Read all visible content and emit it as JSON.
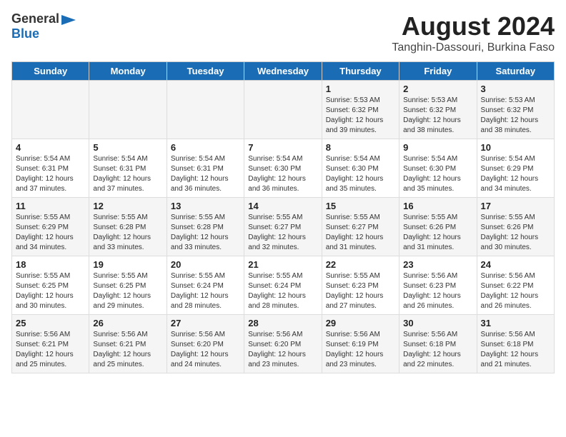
{
  "header": {
    "logo_general": "General",
    "logo_blue": "Blue",
    "title": "August 2024",
    "subtitle": "Tanghin-Dassouri, Burkina Faso"
  },
  "days_of_week": [
    "Sunday",
    "Monday",
    "Tuesday",
    "Wednesday",
    "Thursday",
    "Friday",
    "Saturday"
  ],
  "weeks": [
    [
      {
        "day": "",
        "info": ""
      },
      {
        "day": "",
        "info": ""
      },
      {
        "day": "",
        "info": ""
      },
      {
        "day": "",
        "info": ""
      },
      {
        "day": "1",
        "info": "Sunrise: 5:53 AM\nSunset: 6:32 PM\nDaylight: 12 hours and 39 minutes."
      },
      {
        "day": "2",
        "info": "Sunrise: 5:53 AM\nSunset: 6:32 PM\nDaylight: 12 hours and 38 minutes."
      },
      {
        "day": "3",
        "info": "Sunrise: 5:53 AM\nSunset: 6:32 PM\nDaylight: 12 hours and 38 minutes."
      }
    ],
    [
      {
        "day": "4",
        "info": "Sunrise: 5:54 AM\nSunset: 6:31 PM\nDaylight: 12 hours and 37 minutes."
      },
      {
        "day": "5",
        "info": "Sunrise: 5:54 AM\nSunset: 6:31 PM\nDaylight: 12 hours and 37 minutes."
      },
      {
        "day": "6",
        "info": "Sunrise: 5:54 AM\nSunset: 6:31 PM\nDaylight: 12 hours and 36 minutes."
      },
      {
        "day": "7",
        "info": "Sunrise: 5:54 AM\nSunset: 6:30 PM\nDaylight: 12 hours and 36 minutes."
      },
      {
        "day": "8",
        "info": "Sunrise: 5:54 AM\nSunset: 6:30 PM\nDaylight: 12 hours and 35 minutes."
      },
      {
        "day": "9",
        "info": "Sunrise: 5:54 AM\nSunset: 6:30 PM\nDaylight: 12 hours and 35 minutes."
      },
      {
        "day": "10",
        "info": "Sunrise: 5:54 AM\nSunset: 6:29 PM\nDaylight: 12 hours and 34 minutes."
      }
    ],
    [
      {
        "day": "11",
        "info": "Sunrise: 5:55 AM\nSunset: 6:29 PM\nDaylight: 12 hours and 34 minutes."
      },
      {
        "day": "12",
        "info": "Sunrise: 5:55 AM\nSunset: 6:28 PM\nDaylight: 12 hours and 33 minutes."
      },
      {
        "day": "13",
        "info": "Sunrise: 5:55 AM\nSunset: 6:28 PM\nDaylight: 12 hours and 33 minutes."
      },
      {
        "day": "14",
        "info": "Sunrise: 5:55 AM\nSunset: 6:27 PM\nDaylight: 12 hours and 32 minutes."
      },
      {
        "day": "15",
        "info": "Sunrise: 5:55 AM\nSunset: 6:27 PM\nDaylight: 12 hours and 31 minutes."
      },
      {
        "day": "16",
        "info": "Sunrise: 5:55 AM\nSunset: 6:26 PM\nDaylight: 12 hours and 31 minutes."
      },
      {
        "day": "17",
        "info": "Sunrise: 5:55 AM\nSunset: 6:26 PM\nDaylight: 12 hours and 30 minutes."
      }
    ],
    [
      {
        "day": "18",
        "info": "Sunrise: 5:55 AM\nSunset: 6:25 PM\nDaylight: 12 hours and 30 minutes."
      },
      {
        "day": "19",
        "info": "Sunrise: 5:55 AM\nSunset: 6:25 PM\nDaylight: 12 hours and 29 minutes."
      },
      {
        "day": "20",
        "info": "Sunrise: 5:55 AM\nSunset: 6:24 PM\nDaylight: 12 hours and 28 minutes."
      },
      {
        "day": "21",
        "info": "Sunrise: 5:55 AM\nSunset: 6:24 PM\nDaylight: 12 hours and 28 minutes."
      },
      {
        "day": "22",
        "info": "Sunrise: 5:55 AM\nSunset: 6:23 PM\nDaylight: 12 hours and 27 minutes."
      },
      {
        "day": "23",
        "info": "Sunrise: 5:56 AM\nSunset: 6:23 PM\nDaylight: 12 hours and 26 minutes."
      },
      {
        "day": "24",
        "info": "Sunrise: 5:56 AM\nSunset: 6:22 PM\nDaylight: 12 hours and 26 minutes."
      }
    ],
    [
      {
        "day": "25",
        "info": "Sunrise: 5:56 AM\nSunset: 6:21 PM\nDaylight: 12 hours and 25 minutes."
      },
      {
        "day": "26",
        "info": "Sunrise: 5:56 AM\nSunset: 6:21 PM\nDaylight: 12 hours and 25 minutes."
      },
      {
        "day": "27",
        "info": "Sunrise: 5:56 AM\nSunset: 6:20 PM\nDaylight: 12 hours and 24 minutes."
      },
      {
        "day": "28",
        "info": "Sunrise: 5:56 AM\nSunset: 6:20 PM\nDaylight: 12 hours and 23 minutes."
      },
      {
        "day": "29",
        "info": "Sunrise: 5:56 AM\nSunset: 6:19 PM\nDaylight: 12 hours and 23 minutes."
      },
      {
        "day": "30",
        "info": "Sunrise: 5:56 AM\nSunset: 6:18 PM\nDaylight: 12 hours and 22 minutes."
      },
      {
        "day": "31",
        "info": "Sunrise: 5:56 AM\nSunset: 6:18 PM\nDaylight: 12 hours and 21 minutes."
      }
    ]
  ]
}
